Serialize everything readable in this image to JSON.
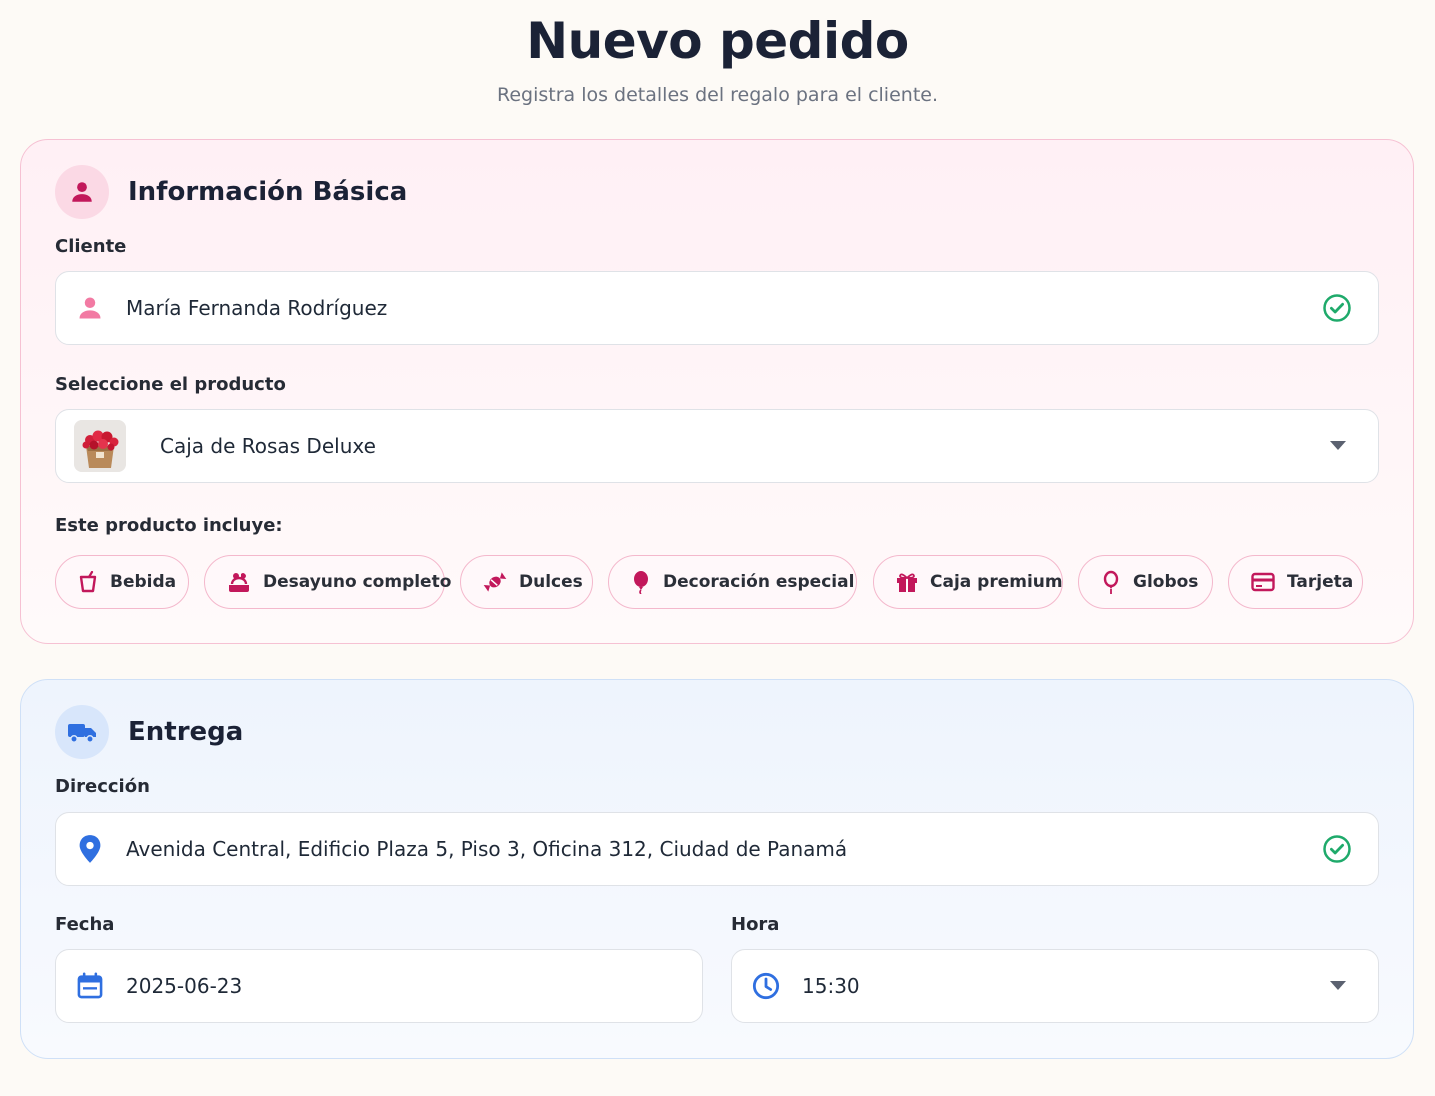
{
  "header": {
    "title": "Nuevo pedido",
    "subtitle": "Registra los detalles del regalo para el cliente."
  },
  "basic_info": {
    "title": "Información Básica",
    "section_icon": "user-icon",
    "client": {
      "label": "Cliente",
      "value": "María Fernanda Rodríguez",
      "lead_icon": "user-icon",
      "status_icon": "check-circle-icon"
    },
    "product": {
      "label": "Seleccione el producto",
      "value": "Caja de Rosas Deluxe",
      "thumbnail": "rose-box-image",
      "trail_icon": "chevron-down-icon"
    },
    "includes": {
      "label": "Este producto incluye:",
      "items": [
        {
          "label": "Bebida",
          "icon": "cup-icon"
        },
        {
          "label": "Desayuno completo",
          "icon": "breakfast-icon"
        },
        {
          "label": "Dulces",
          "icon": "candy-icon"
        },
        {
          "label": "Decoración especial",
          "icon": "balloon-icon"
        },
        {
          "label": "Caja premium",
          "icon": "gift-icon"
        },
        {
          "label": "Globos",
          "icon": "balloon-outline-icon"
        },
        {
          "label": "Tarjeta",
          "icon": "card-icon"
        }
      ]
    }
  },
  "delivery": {
    "title": "Entrega",
    "section_icon": "truck-icon",
    "address": {
      "label": "Dirección",
      "value": "Avenida Central, Edificio Plaza 5, Piso 3, Oficina 312, Ciudad de Panamá",
      "lead_icon": "location-pin-icon",
      "status_icon": "check-circle-icon"
    },
    "date": {
      "label": "Fecha",
      "value": "2025-06-23",
      "lead_icon": "calendar-icon"
    },
    "time": {
      "label": "Hora",
      "value": "15:30",
      "lead_icon": "clock-icon",
      "trail_icon": "chevron-down-icon"
    }
  },
  "colors": {
    "accent_pink": "#c2185b",
    "accent_blue": "#2f6fe0",
    "success_green": "#1faa6b"
  }
}
